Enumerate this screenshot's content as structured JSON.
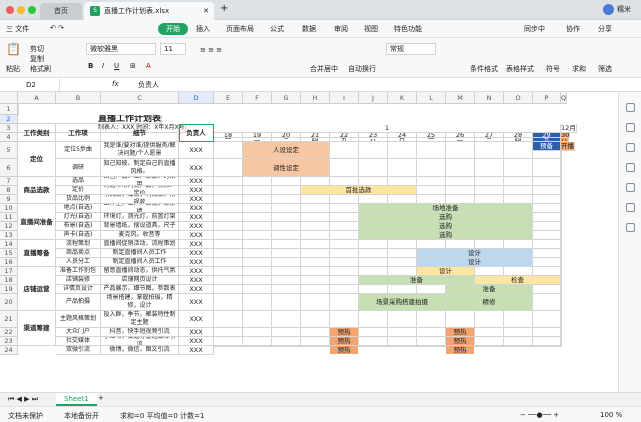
{
  "titlebar": {
    "home_tab": "首页",
    "doc_tab": "直播工作计划表.xlsx",
    "xls_badge": "S",
    "user": "糯米"
  },
  "menu": {
    "file": "三 文件",
    "items": [
      "开始",
      "插入",
      "页面布局",
      "公式",
      "数据",
      "审阅",
      "视图",
      "特色功能"
    ],
    "sync": "同步中",
    "collab": "协作",
    "share": "分享"
  },
  "ribbon": {
    "paste": "粘贴",
    "cut": "剪切",
    "copy": "复制",
    "format_painter": "格式刷",
    "font": "微软雅黑",
    "size": "11",
    "merge": "合并居中",
    "wrap": "自动换行",
    "numfmt": "常规",
    "cond": "条件格式",
    "table_style": "表格样式",
    "symbol": "符号",
    "sum": "求和",
    "filter": "筛选"
  },
  "formula": {
    "cellref": "D2",
    "fx": "fx",
    "value": "负责人"
  },
  "cols": [
    "A",
    "B",
    "C",
    "D",
    "E",
    "F",
    "G",
    "H",
    "I",
    "J",
    "K",
    "L",
    "M",
    "N",
    "O",
    "P",
    "Q"
  ],
  "rows": [
    "1",
    "2",
    "3",
    "4",
    "5",
    "6",
    "7",
    "8",
    "9",
    "10",
    "11",
    "12",
    "13",
    "14",
    "15",
    "16",
    "17",
    "18",
    "19",
    "20",
    "21",
    "22",
    "23",
    "24"
  ],
  "title": "直播工作计划表",
  "subtitle": "制表人：XXX  时间：X年X月X号",
  "headers": {
    "type": "工作类别",
    "item": "工作项",
    "detail": "细节",
    "owner": "负责人"
  },
  "month1": "1",
  "month2": "12月",
  "days": [
    "18",
    "19",
    "20",
    "21",
    "22",
    "23",
    "24",
    "25",
    "26",
    "27",
    "28",
    "29",
    "30"
  ],
  "weekdays": [
    "一",
    "二",
    "三",
    "四",
    "五",
    "六",
    "日",
    "一",
    "二",
    "三",
    "四",
    "五",
    "六"
  ],
  "categories": [
    "定位",
    "商品选款",
    "直播间准备",
    "直播筹备",
    "店铺运营",
    "渠道筹建"
  ],
  "items": [
    "定位5步曲",
    "调研",
    "选品",
    "定价",
    "货品比例",
    "地点(自选)",
    "灯光(自选)",
    "布景(自选)",
    "声卡(自选)",
    "流程策划",
    "商品卖点",
    "人员分工",
    "准备工作别包",
    "店铺装修",
    "详情页设计",
    "产品拍摄",
    "主题风格策划",
    "大众门户",
    "社交媒体",
    "双微引流"
  ],
  "details": [
    "我是谁/要对谁/提供服务/解决问题/个人愿景",
    "知己知彼、制定自己的直播风格。",
    "自营产品、工厂渠源、时采用",
    "对比市场同类产品，卖点、定价",
    "引流款，爆款，利润款，常规款",
    "工作室，工厂、店铺，背景墙",
    "环境灯，测光灯，前置灯架",
    "背景墙纸，摆设道具，尺子",
    "麦克风，收音等",
    "直播间促销活动，流程策划",
    "制定直播间人员工作",
    "制定直播间人员工作",
    "留意直播间动态，供托气氛",
    "店铺网页设计",
    "产品展示，细节图，参数表",
    "场景搭建，掌握拍摄，精修，设计",
    "投入群，季节，聚装特性制定主题",
    "抖音，快手短视频引流",
    "小红书，爱逛等普通媒体引流",
    "微博，微信，图文引流"
  ],
  "owner": "XXX",
  "bars": [
    "人设设定",
    "调性设定",
    "首批选款",
    "场地准备",
    "选购",
    "选购",
    "选购",
    "设计",
    "设计",
    "设计",
    "准备",
    "检查",
    "准备",
    "场景采购搭建拍摄",
    "精修",
    "预热",
    "预热",
    "预热",
    "预热",
    "预热",
    "预热",
    "预备",
    "开播"
  ],
  "tabbar": {
    "sheet": "Sheet1"
  },
  "status": {
    "protect": "文档未保护",
    "backup": "本地备份开",
    "stats": "求和=0  平均值=0  计数=1",
    "zoom": "100 %"
  },
  "colors": {
    "accent": "#1fa463",
    "orange": "#f7c7a4",
    "yellow": "#fde6a3",
    "green": "#c6e0b4",
    "blue": "#bdd7ee",
    "navy": "#2f5fa8",
    "peach": "#f4a56f"
  }
}
